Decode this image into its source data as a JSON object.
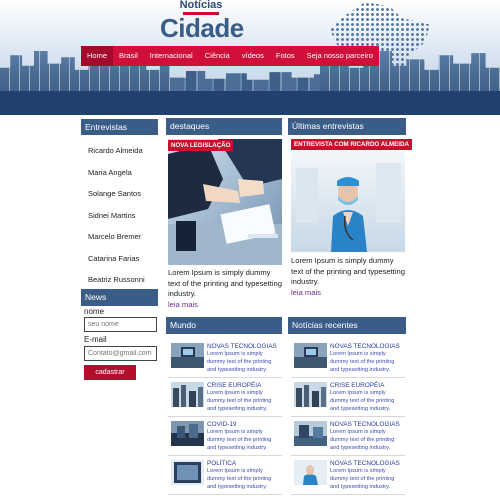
{
  "header": {
    "logo_top": "Notícias",
    "logo_main": "Cidade",
    "nav": [
      "Home",
      "Brasil",
      "Internacional",
      "Ciência",
      "vídeos",
      "Fotos",
      "Seja nosso parceiro"
    ]
  },
  "sidebar": {
    "title": "Entrevistas",
    "people": [
      "Ricardo Almeida",
      "Maria Angela",
      "Solange Santos",
      "Sidnei Martins",
      "Marcelo Bremer",
      "Catarina Farias",
      "Beatriz Russonni"
    ],
    "news": {
      "title": "News",
      "name_label": "nome",
      "name_placeholder": "seu nome",
      "email_label": "E-mail",
      "email_placeholder": "Contato@gmail.com",
      "submit": "cadastrar"
    }
  },
  "destaques": {
    "title": "destaques",
    "tag": "NOVA LEGISLAÇÃO",
    "text": "Lorem Ipsum is simply dummy text of the printing and typesetting industry.",
    "link": "leia mais"
  },
  "entrevistas": {
    "title": "Últimas entrevistas",
    "tag": "ENTREVISTA COM RICARDO ALMEIDA",
    "text": "Lorem Ipsum is simply dummy text of the printing and typesetting industry.",
    "link": "leia mais"
  },
  "mundo": {
    "title": "Mundo",
    "items": [
      {
        "title": "NOVAS TECNOLOGIAS",
        "desc": "Lorem Ipsum is simply dummy text of the printing and typesetting industry."
      },
      {
        "title": "CRISE EUROPÉIA",
        "desc": "Lorem Ipsum is simply dummy text of the printing and typesetting industry."
      },
      {
        "title": "COVID-19",
        "desc": "Lorem Ipsum is simply dummy text of the printing and typesetting industry."
      },
      {
        "title": "POLÍTICA",
        "desc": "Lorem Ipsum is simply dummy text of the printing and typesetting industry."
      }
    ]
  },
  "recentes": {
    "title": "Notícias recentes",
    "items": [
      {
        "title": "NOVAS TECNOLOGIAS",
        "desc": "Lorem Ipsum is simply dummy text of the printing and typesetting industry."
      },
      {
        "title": "CRISE EUROPÉIA",
        "desc": "Lorem Ipsum is simply dummy text of the printing and typesetting industry."
      },
      {
        "title": "NOVAS TECNOLOGIAS",
        "desc": "Lorem Ipsum is simply dummy text of the printing and typesetting industry."
      },
      {
        "title": "NOVAS TECNOLOGIAS",
        "desc": "Lorem Ipsum is simply dummy text of the printing and typesetting industry."
      }
    ]
  },
  "colors": {
    "brand_blue": "#3a5d88",
    "accent_red": "#c8102e",
    "link_purple": "#6b2d8a"
  }
}
